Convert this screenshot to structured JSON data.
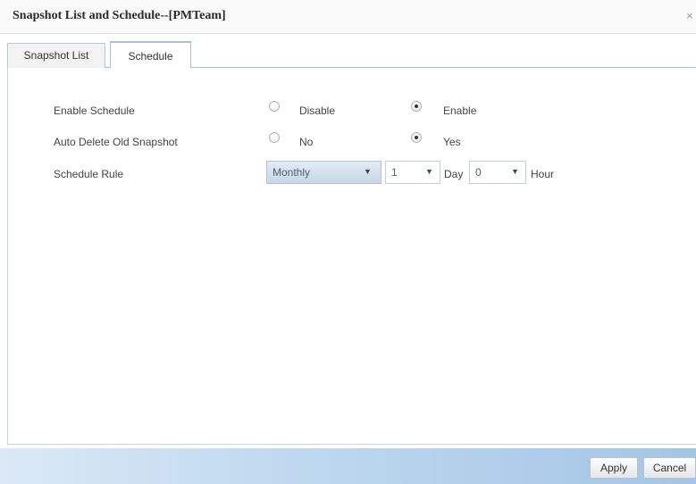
{
  "window": {
    "title": "Snapshot List and Schedule--[PMTeam]",
    "close_glyph": "×"
  },
  "tabs": [
    {
      "label": "Snapshot List",
      "active": false
    },
    {
      "label": "Schedule",
      "active": true
    }
  ],
  "schedule": {
    "enable": {
      "label": "Enable Schedule",
      "options": [
        "Disable",
        "Enable"
      ],
      "selected": "Enable"
    },
    "auto_delete": {
      "label": "Auto Delete Old Snapshot",
      "options": [
        "No",
        "Yes"
      ],
      "selected": "Yes"
    },
    "rule": {
      "label": "Schedule Rule",
      "frequency": "Monthly",
      "day_value": "1",
      "day_label": "Day",
      "hour_value": "0",
      "hour_label": "Hour",
      "arrow_glyph": "▼"
    }
  },
  "footer": {
    "apply_label": "Apply",
    "cancel_label": "Cancel"
  },
  "colors": {
    "footer_gradient_start": "#dbe9f6",
    "footer_gradient_end": "#a3c5e6",
    "tab_border": "#a9bfd6"
  }
}
